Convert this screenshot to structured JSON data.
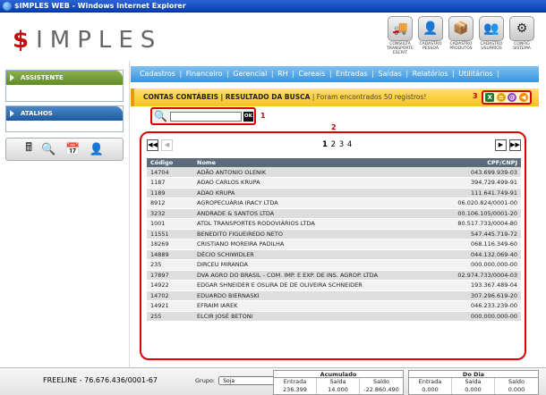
{
  "window": {
    "title": "$IMPLES WEB - Windows Internet Explorer"
  },
  "logo": {
    "dollar": "$",
    "text": "IMPLES"
  },
  "header_icons": [
    {
      "label": "CONSULTA TRANSPORTE ESCRIT",
      "icon": "truck-icon",
      "glyph": "🚚"
    },
    {
      "label": "CADASTRO PESSOA",
      "icon": "person-icon",
      "glyph": "👤"
    },
    {
      "label": "CADASTRO PRODUTOS",
      "icon": "box-icon",
      "glyph": "📦"
    },
    {
      "label": "CADASTRO USUÁRIOS",
      "icon": "users-icon",
      "glyph": "👥"
    },
    {
      "label": "CONFIG SISTEMA",
      "icon": "gear-icon",
      "glyph": "⚙"
    }
  ],
  "sidebar": {
    "assistente": "ASSISTENTE",
    "atalhos": "ATALHOS",
    "tools": [
      {
        "icon": "calculator-icon",
        "glyph": "🖩"
      },
      {
        "icon": "magnifier-icon",
        "glyph": "🔍"
      },
      {
        "icon": "calendar-icon",
        "glyph": "📅"
      },
      {
        "icon": "user-icon",
        "glyph": "👤"
      }
    ]
  },
  "nav": {
    "items": [
      "Cadastros",
      "Financeiro",
      "Gerencial",
      "RH",
      "Cereais",
      "Entradas",
      "Saídas",
      "Relatórios",
      "Utilitários"
    ]
  },
  "infobar": {
    "section": "CONTAS CONTÁBEIS",
    "subsection": "RESULTADO DA BUSCA",
    "message": "Foram encontrados 50 registros!"
  },
  "annotations": {
    "one": "1",
    "two": "2",
    "three": "3"
  },
  "export_icons": [
    {
      "icon": "excel-icon",
      "color": "#1e7d32",
      "glyph": "X"
    },
    {
      "icon": "print-icon",
      "color": "#e0a000",
      "glyph": "≡"
    },
    {
      "icon": "mail-icon",
      "color": "#8a3ac0",
      "glyph": "@"
    },
    {
      "icon": "back-icon",
      "color": "#f08a00",
      "glyph": "◀"
    }
  ],
  "search": {
    "value": "",
    "ok_label": "OK"
  },
  "pager": {
    "first": "◀◀",
    "prev": "◀",
    "next": "▶",
    "last": "▶▶",
    "pages": [
      "1",
      "2",
      "3",
      "4"
    ],
    "current": "1"
  },
  "table": {
    "headers": [
      "Código",
      "Nome",
      "CPF/CNPJ"
    ],
    "rows": [
      [
        "14704",
        "ADÃO ANTONIO OLENIK",
        "043.699.939-03"
      ],
      [
        "1187",
        "ADAO CARLOS KRUPA",
        "394.729.499-91"
      ],
      [
        "1189",
        "ADAO KRUPA",
        "111.641.749-91"
      ],
      [
        "8912",
        "AGROPECUÁRIA IRACY LTDA",
        "06.020.824/0001-00"
      ],
      [
        "3232",
        "ANDRADE & SANTOS LTDA",
        "00.106.105/0001-20"
      ],
      [
        "1001",
        "ATDL TRANSPORTES RODOVIÁRIOS LTDA",
        "80.517.733/0004-80"
      ],
      [
        "11551",
        "BENEDITO FIGUEIREDO NETO",
        "547.445.719-72"
      ],
      [
        "18269",
        "CRISTIANO MOREIRA PADILHA",
        "068.116.349-60"
      ],
      [
        "14889",
        "DÉCIO SCHIWIDLER",
        "044.132.069-40"
      ],
      [
        "235",
        "DIRCEU MIRANDA",
        "000.000.000-00"
      ],
      [
        "17897",
        "DVA AGRO DO BRASIL - COM. IMP. E EXP. DE INS. AGROP. LTDA",
        "02.974.733/0004-03"
      ],
      [
        "14922",
        "EDGAR SHNEIDER E OSLIRA DE DE OLIVEIRA SCHNEIDER",
        "193.367.489-04"
      ],
      [
        "14702",
        "EDUARDO BIERNASKI",
        "307.296.619-20"
      ],
      [
        "14921",
        "EFRAIM IAREK",
        "046.233.239-00"
      ],
      [
        "255",
        "ELCIR JOSÉ BETONI",
        "000.000.000-00"
      ]
    ]
  },
  "footer": {
    "company": "FREELINE - 76.676.436/0001-67",
    "grupo_label": "Grupo:",
    "grupo_value": "Soja",
    "acumulado": {
      "title": "Acumulado",
      "headers": [
        "Entrada",
        "Saída",
        "Saldo"
      ],
      "values": [
        "236.399",
        "14.000",
        "-22.860.490"
      ]
    },
    "dodia": {
      "title": "Do Dia",
      "headers": [
        "Entrada",
        "Saída",
        "Saldo"
      ],
      "values": [
        "0.000",
        "0.000",
        "0.000"
      ]
    }
  }
}
